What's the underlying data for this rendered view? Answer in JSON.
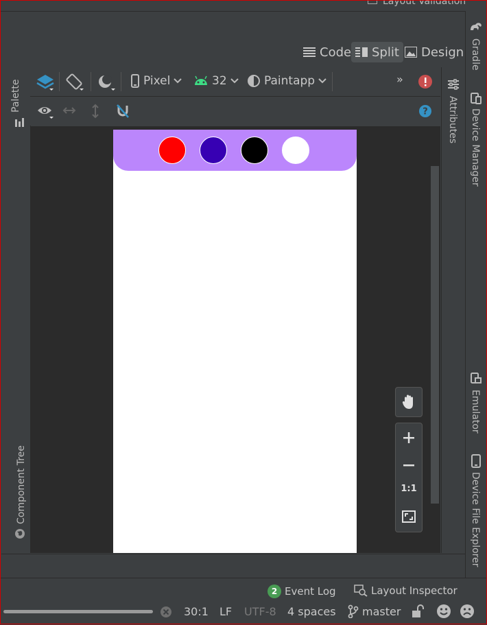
{
  "top_strip": {
    "label": "Layout Validation"
  },
  "modes": {
    "code": "Code",
    "split": "Split",
    "design": "Design"
  },
  "toolbar": {
    "device": "Pixel",
    "api": "32",
    "theme": "Paintapp",
    "overflow": "»"
  },
  "left_panel": {
    "palette": "Palette",
    "component_tree": "Component Tree"
  },
  "right_panel": {
    "attributes": "Attributes",
    "gradle": "Gradle",
    "device_manager": "Device Manager",
    "emulator": "Emulator",
    "device_file_explorer": "Device File Explorer"
  },
  "zoom": {
    "one_to_one": "1:1"
  },
  "colors": {
    "accent": "#bb86fc",
    "swatch_red": "#ff0000",
    "swatch_purple": "#3700b3",
    "swatch_black": "#000000",
    "swatch_white": "#ffffff"
  },
  "bottom_bar": {
    "event_log_count": "2",
    "event_log": "Event Log",
    "layout_inspector": "Layout Inspector",
    "position": "30:1",
    "line_ending": "LF",
    "encoding": "UTF-8",
    "indent": "4 spaces",
    "branch": "master"
  }
}
